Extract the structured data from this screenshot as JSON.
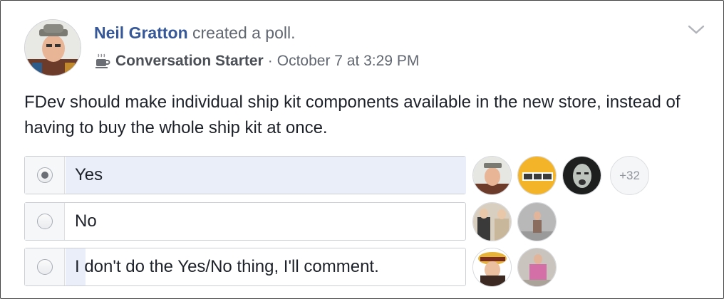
{
  "post": {
    "author": "Neil Gratton",
    "action": "created a poll.",
    "badge": "Conversation Starter",
    "separator": "·",
    "timestamp": "October 7 at 3:29 PM",
    "text": "FDev should make individual ship kit components available in the new store, instead of having to buy the whole ship kit at once.",
    "options_icon": "chevron-down-icon",
    "badge_icon": "coffee-cup-icon"
  },
  "poll": {
    "options": [
      {
        "label": "Yes",
        "selected": true,
        "vote_fraction": 1.0
      },
      {
        "label": "No",
        "selected": false,
        "vote_fraction": 0.0
      },
      {
        "label": "I don't do the Yes/No thing, I'll comment.",
        "selected": false,
        "vote_fraction": 0.05
      }
    ],
    "more_voters_label": "+32"
  },
  "colors": {
    "link": "#365899",
    "vote_bar": "#e9eef8",
    "text": "#1d2129",
    "muted": "#616770"
  }
}
